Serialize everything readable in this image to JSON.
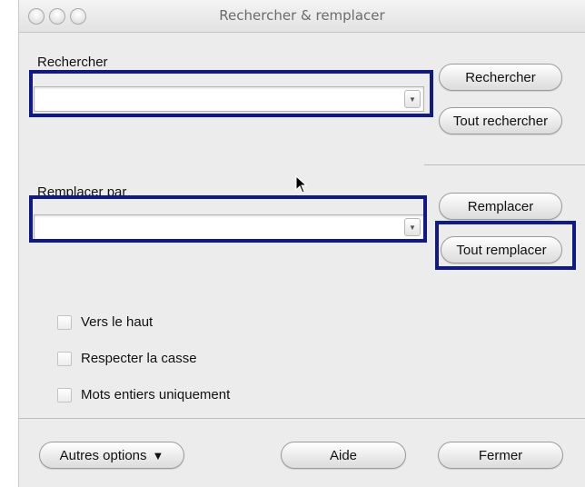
{
  "window": {
    "title": "Rechercher & remplacer"
  },
  "search": {
    "label": "Rechercher",
    "value": "",
    "dropdown_icon": "chevron-down-icon"
  },
  "replace": {
    "label": "Remplacer par",
    "value": "",
    "dropdown_icon": "chevron-down-icon"
  },
  "buttons": {
    "find": "Rechercher",
    "find_all": "Tout rechercher",
    "replace": "Remplacer",
    "replace_all": "Tout remplacer",
    "more_options": "Autres options",
    "help": "Aide",
    "close": "Fermer"
  },
  "options": {
    "backwards": {
      "label": "Vers le haut",
      "checked": false
    },
    "match_case": {
      "label": "Respecter la casse",
      "checked": false
    },
    "whole_words": {
      "label": "Mots entiers uniquement",
      "checked": false
    }
  },
  "highlight_color": "#0f1a86"
}
